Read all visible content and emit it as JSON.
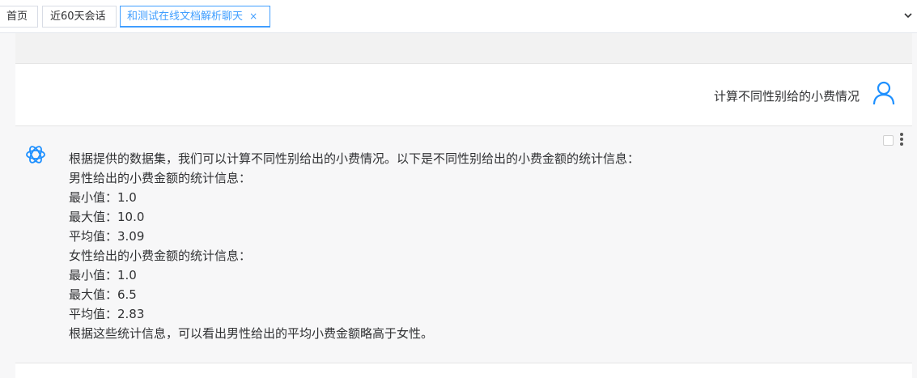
{
  "tabs": {
    "home": "首页",
    "recent": "近60天会话",
    "active": "和测试在线文档解析聊天",
    "close_glyph": "×"
  },
  "icons": {
    "tab_dropdown": "chevron-down-icon",
    "user_avatar": "user-icon",
    "bot_avatar": "openai-logo-icon",
    "more": "more-vertical-icon"
  },
  "colors": {
    "accent": "#409eff",
    "user_icon": "#1e90ff"
  },
  "chat": {
    "user_message": "计算不同性别给的小费情况",
    "bot_lines": [
      "根据提供的数据集，我们可以计算不同性别给出的小费情况。以下是不同性别给出的小费金额的统计信息：",
      "男性给出的小费金额的统计信息：",
      "最小值：1.0",
      "最大值：10.0",
      "平均值：3.09",
      "女性给出的小费金额的统计信息：",
      "最小值：1.0",
      "最大值：6.5",
      "平均值：2.83",
      "根据这些统计信息，可以看出男性给出的平均小费金额略高于女性。"
    ]
  }
}
